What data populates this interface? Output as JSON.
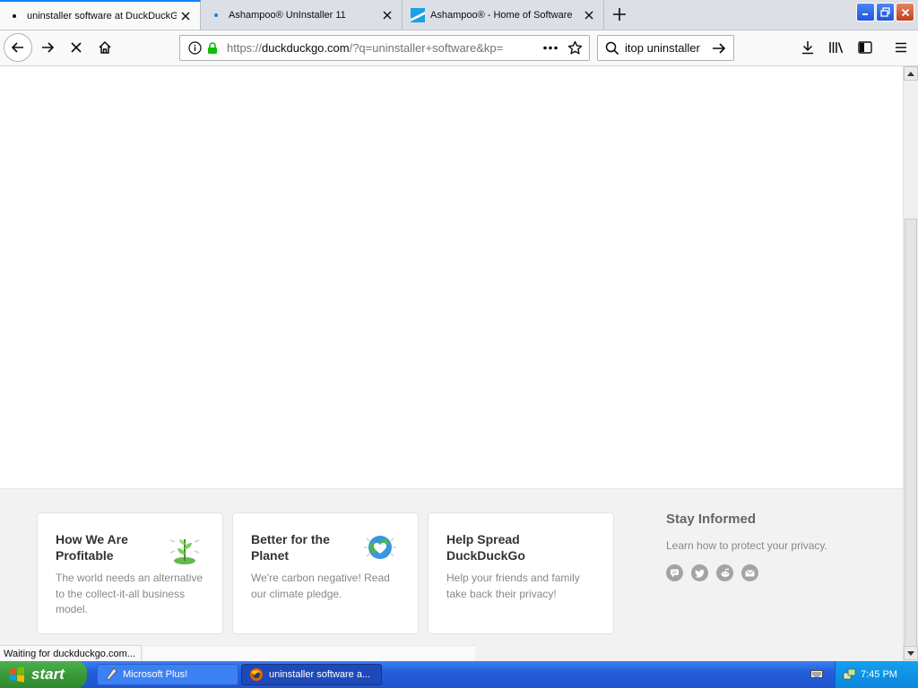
{
  "tabs": [
    {
      "title": "uninstaller software at DuckDuckGo",
      "active": true
    },
    {
      "title": "Ashampoo® UnInstaller 11",
      "active": false
    },
    {
      "title": "Ashampoo® - Home of Software",
      "active": false
    }
  ],
  "nav": {
    "url_protocol": "https://",
    "url_host": "duckduckgo.com",
    "url_rest": "/?q=uninstaller+software&kp=",
    "search_value": "itop uninstaller"
  },
  "footer_cards": [
    {
      "title": "How We Are Profitable",
      "text": "The world needs an alternative to the collect-it-all business model."
    },
    {
      "title": "Better for the Planet",
      "text": "We're carbon negative! Read our climate pledge."
    },
    {
      "title": "Help Spread DuckDuckGo",
      "text": "Help your friends and family take back their privacy!"
    }
  ],
  "stay": {
    "title": "Stay Informed",
    "text": "Learn how to protect your privacy."
  },
  "status": "Waiting for duckduckgo.com...",
  "taskbar": {
    "start_label": "start",
    "tasks": [
      "Microsoft Plus!",
      "uninstaller software a..."
    ],
    "clock": "7:45 PM"
  },
  "colors": {
    "accent": "#0a84ff",
    "taskbar": "#245edb",
    "start": "#3a9a3a"
  }
}
